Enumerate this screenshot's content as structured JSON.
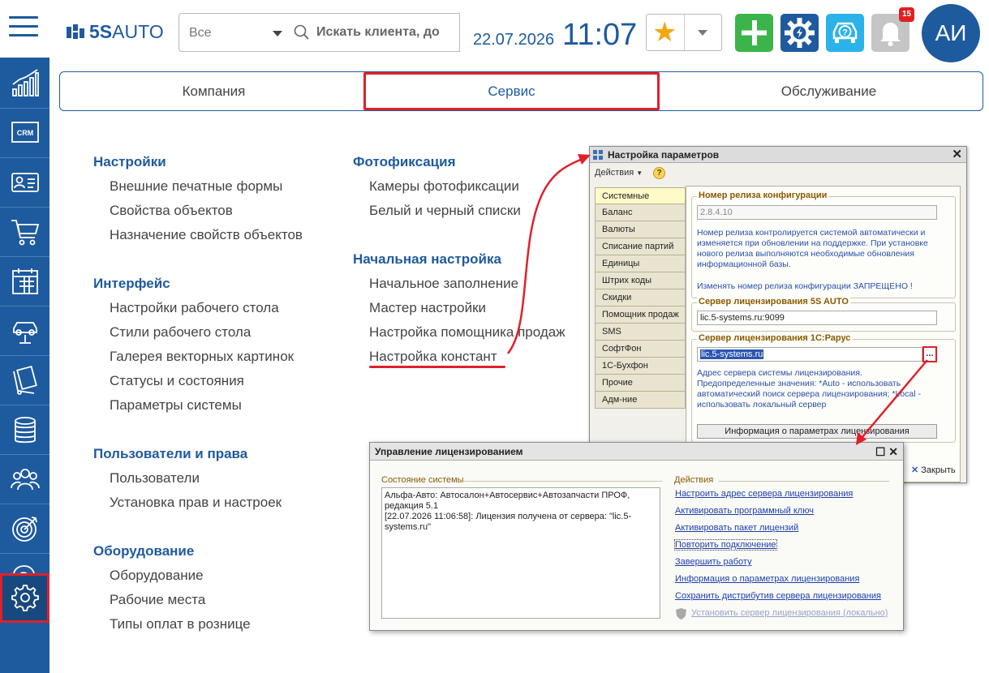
{
  "header": {
    "logo_text_bold": "5S",
    "logo_text_thin": "AUTO",
    "filter_value": "Все",
    "search_placeholder": "Искать клиента, до",
    "date": "22.07.2026",
    "time": "11:07",
    "notifications_count": "15",
    "avatar_initials": "АИ"
  },
  "sidebar": {
    "items": [
      "analytics-icon",
      "crm-icon",
      "clients-icon",
      "cart-icon",
      "calendar-icon",
      "car-lift-icon",
      "documents-icon",
      "finance-icon",
      "team-icon",
      "target-icon",
      "support-icon",
      "settings-icon"
    ]
  },
  "tabs": [
    "Компания",
    "Сервис",
    "Обслуживание"
  ],
  "menu": {
    "col1": [
      {
        "head": "Настройки",
        "items": [
          "Внешние печатные формы",
          "Свойства объектов",
          "Назначение свойств объектов"
        ]
      },
      {
        "head": "Интерфейс",
        "items": [
          "Настройки рабочего стола",
          "Стили рабочего стола",
          "Галерея векторных картинок",
          "Статусы и состояния",
          "Параметры системы"
        ]
      },
      {
        "head": "Пользователи и права",
        "items": [
          "Пользователи",
          "Установка прав и настроек"
        ]
      },
      {
        "head": "Оборудование",
        "items": [
          "Оборудование",
          "Рабочие места",
          "Типы оплат в рознице"
        ]
      }
    ],
    "col2": [
      {
        "head": "Фотофиксация",
        "items": [
          "Камеры фотофиксации",
          "Белый и черный списки"
        ]
      },
      {
        "head": "Начальная настройка",
        "items": [
          "Начальное заполнение",
          "Мастер настройки",
          "Настройка помощника продаж",
          "Настройка констант"
        ]
      }
    ]
  },
  "settings_dialog": {
    "title": "Настройка параметров",
    "actions_menu": "Действия",
    "help": "?",
    "tabs": [
      "Системные",
      "Баланс",
      "Валюты",
      "Списание партий",
      "Единицы",
      "Штрих коды",
      "Скидки",
      "Помощник продаж",
      "SMS",
      "СофтФон",
      "1С-Бухфон",
      "Прочие",
      "Адм-ние"
    ],
    "release_group": "Номер релиза конфигурации",
    "release_value": "2.8.4.10",
    "release_note": "Номер релиза контролируется системой автоматически и изменяется при обновлении на поддержке. При установке нового релиза выполняются необходимые обновления информационной базы.",
    "release_warning": "Изменять номер релиза конфигурации ЗАПРЕЩЕНО !",
    "lic5s_group": "Сервер лицензирования  5S AUTO",
    "lic5s_value": "lic.5-systems.ru:9099",
    "lic1c_group": "Сервер лицензирования 1С:Рарус",
    "lic1c_value": "lic.5-systems.ru",
    "lic1c_button": "...",
    "lic1c_note": "Адрес сервера системы лицензирования. Предопределенные значения: *Auto - использовать автоматический поиск сервера лицензирования; *Local - использовать локальный сервер",
    "info_button": "Информация о параметрах лицензирования",
    "close_label": "Закрыть"
  },
  "license_dialog": {
    "title": "Управление лицензированием",
    "state_header": "Состояние системы",
    "state_text": "Альфа-Авто: Автосалон+Автосервис+Автозапчасти ПРОФ, редакция 5.1\n[22.07.2026 11:06:58]: Лицензия получена от сервера: \"lic.5-systems.ru\"",
    "actions_header": "Действия",
    "actions": [
      "Настроить адрес сервера лицензирования",
      "Активировать программный ключ",
      "Активировать пакет лицензий",
      "Повторить подключение",
      "Завершить работу",
      "Информация о параметрах лицензирования",
      "Сохранить дистрибутив сервера лицензирования"
    ],
    "disabled_action": "Установить сервер лицензирования (локально)"
  },
  "colors": {
    "brand": "#1e5a9e",
    "highlight": "#e0202a"
  }
}
